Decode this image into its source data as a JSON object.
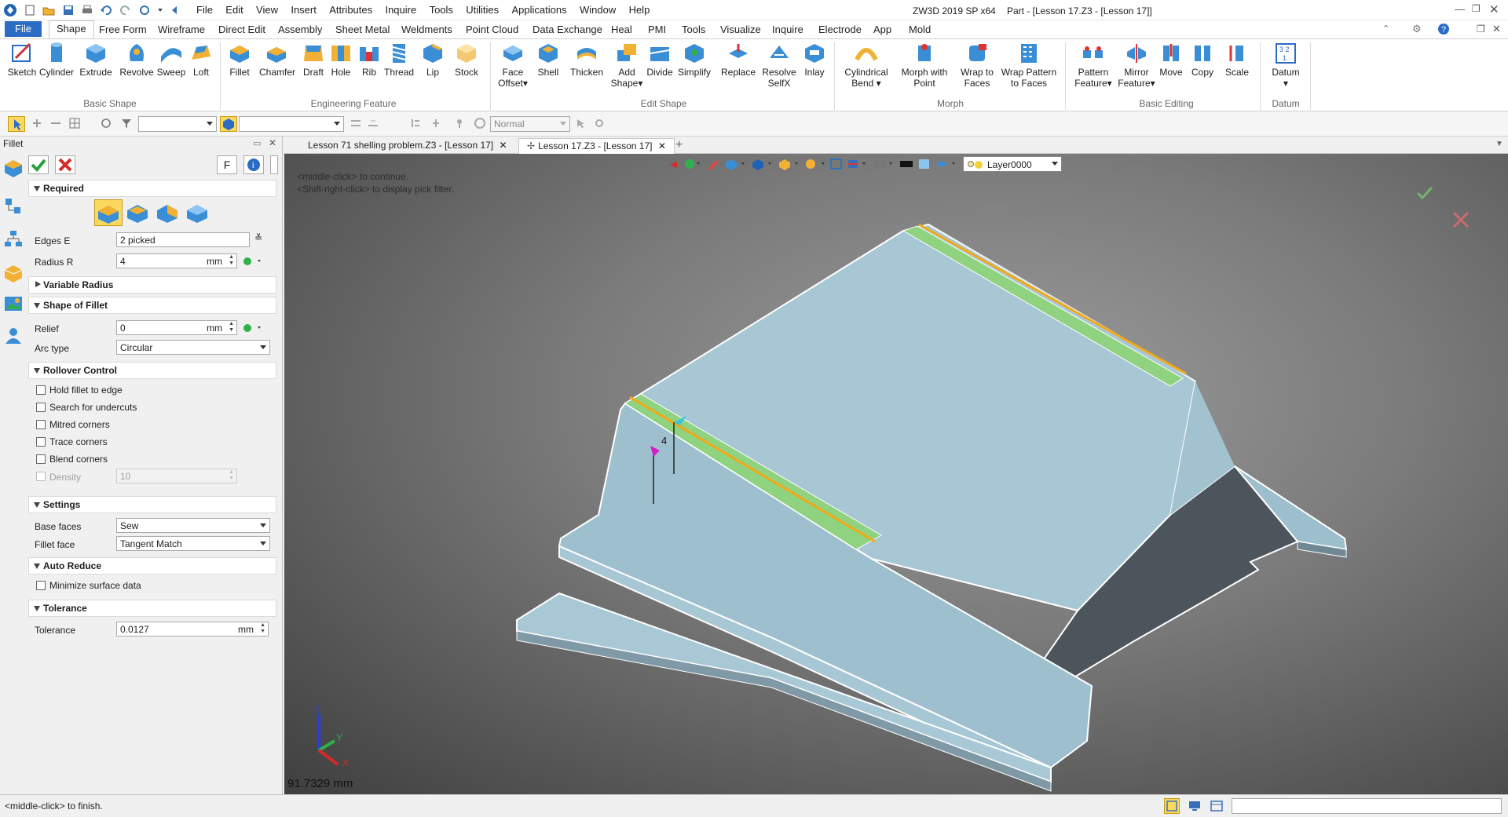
{
  "title": {
    "app": "ZW3D 2019 SP x64",
    "doc": "Part - [Lesson 17.Z3 - [Lesson 17]]"
  },
  "menu": [
    "File",
    "Edit",
    "View",
    "Insert",
    "Attributes",
    "Inquire",
    "Tools",
    "Utilities",
    "Applications",
    "Window",
    "Help"
  ],
  "ribbon_tabs": [
    "File",
    "Shape",
    "Free Form",
    "Wireframe",
    "Direct Edit",
    "Assembly",
    "Sheet Metal",
    "Weldments",
    "Point Cloud",
    "Data Exchange",
    "Heal",
    "PMI",
    "Tools",
    "Visualize",
    "Inquire",
    "Electrode",
    "App",
    "Mold"
  ],
  "tools": {
    "sketch": "Sketch",
    "cylinder": "Cylinder",
    "extrude": "Extrude",
    "revolve": "Revolve",
    "sweep": "Sweep",
    "loft": "Loft",
    "fillet": "Fillet",
    "chamfer": "Chamfer",
    "draft": "Draft",
    "hole": "Hole",
    "rib": "Rib",
    "thread": "Thread",
    "lip": "Lip",
    "stock": "Stock",
    "face_offset_1": "Face",
    "face_offset_2": "Offset",
    "shell": "Shell",
    "thicken": "Thicken",
    "add_shape_1": "Add",
    "add_shape_2": "Shape",
    "divide": "Divide",
    "simplify": "Simplify",
    "replace": "Replace",
    "resolve_1": "Resolve",
    "resolve_2": "SelfX",
    "inlay": "Inlay",
    "cyl_bend_1": "Cylindrical",
    "cyl_bend_2": "Bend",
    "morph_point_1": "Morph with",
    "morph_point_2": "Point",
    "wrap_faces_1": "Wrap to",
    "wrap_faces_2": "Faces",
    "wrap_pattern_1": "Wrap Pattern",
    "wrap_pattern_2": "to Faces",
    "pattern_1": "Pattern",
    "pattern_2": "Feature",
    "mirror_1": "Mirror",
    "mirror_2": "Feature",
    "move": "Move",
    "copy": "Copy",
    "scale": "Scale",
    "datum": "Datum"
  },
  "groups": {
    "basic_shape": "Basic Shape",
    "engineering": "Engineering Feature",
    "edit_shape": "Edit Shape",
    "morph": "Morph",
    "basic_editing": "Basic Editing",
    "datum": "Datum"
  },
  "filterbar": {
    "mode": "Normal"
  },
  "doc_tabs": [
    "Lesson 71 shelling problem.Z3 - [Lesson 17]",
    "Lesson 17.Z3 - [Lesson 17]"
  ],
  "panel": {
    "title": "Fillet",
    "f_button": "F",
    "required": "Required",
    "edges_label": "Edges E",
    "edges_value": "2 picked",
    "radius_label": "Radius R",
    "radius_value": "4",
    "unit": "mm",
    "variable_radius": "Variable Radius",
    "shape_of_fillet": "Shape of Fillet",
    "relief_label": "Relief",
    "relief_value": "0",
    "arc_type_label": "Arc type",
    "arc_type_value": "Circular",
    "rollover": "Rollover Control",
    "cb_hold": "Hold fillet to edge",
    "cb_search": "Search for undercuts",
    "cb_mitred": "Mitred corners",
    "cb_trace": "Trace corners",
    "cb_blend": "Blend corners",
    "density_label": "Density",
    "density_value": "10",
    "settings": "Settings",
    "base_faces_label": "Base faces",
    "base_faces_value": "Sew",
    "fillet_face_label": "Fillet face",
    "fillet_face_value": "Tangent Match",
    "auto_reduce": "Auto Reduce",
    "cb_minimize": "Minimize surface data",
    "tolerance_section": "Tolerance",
    "tolerance_label": "Tolerance",
    "tolerance_value": "0.0127"
  },
  "viewport": {
    "hint1": "<middle-click> to continue.",
    "hint2": "<Shift-right-click> to display pick filter.",
    "layer": "Layer0000",
    "radius_tag": "4",
    "measure": "91.7329 mm",
    "axis_x": "X",
    "axis_y": "Y",
    "axis_z": "Z"
  },
  "status": {
    "message": "<middle-click> to finish."
  },
  "colors": {
    "accent": "#2b6cc4",
    "fillet_face": "#8fd27f",
    "edge_highlight": "#f4a816",
    "body_top": "#a4c4d2",
    "body_dark": "#4a5258"
  }
}
